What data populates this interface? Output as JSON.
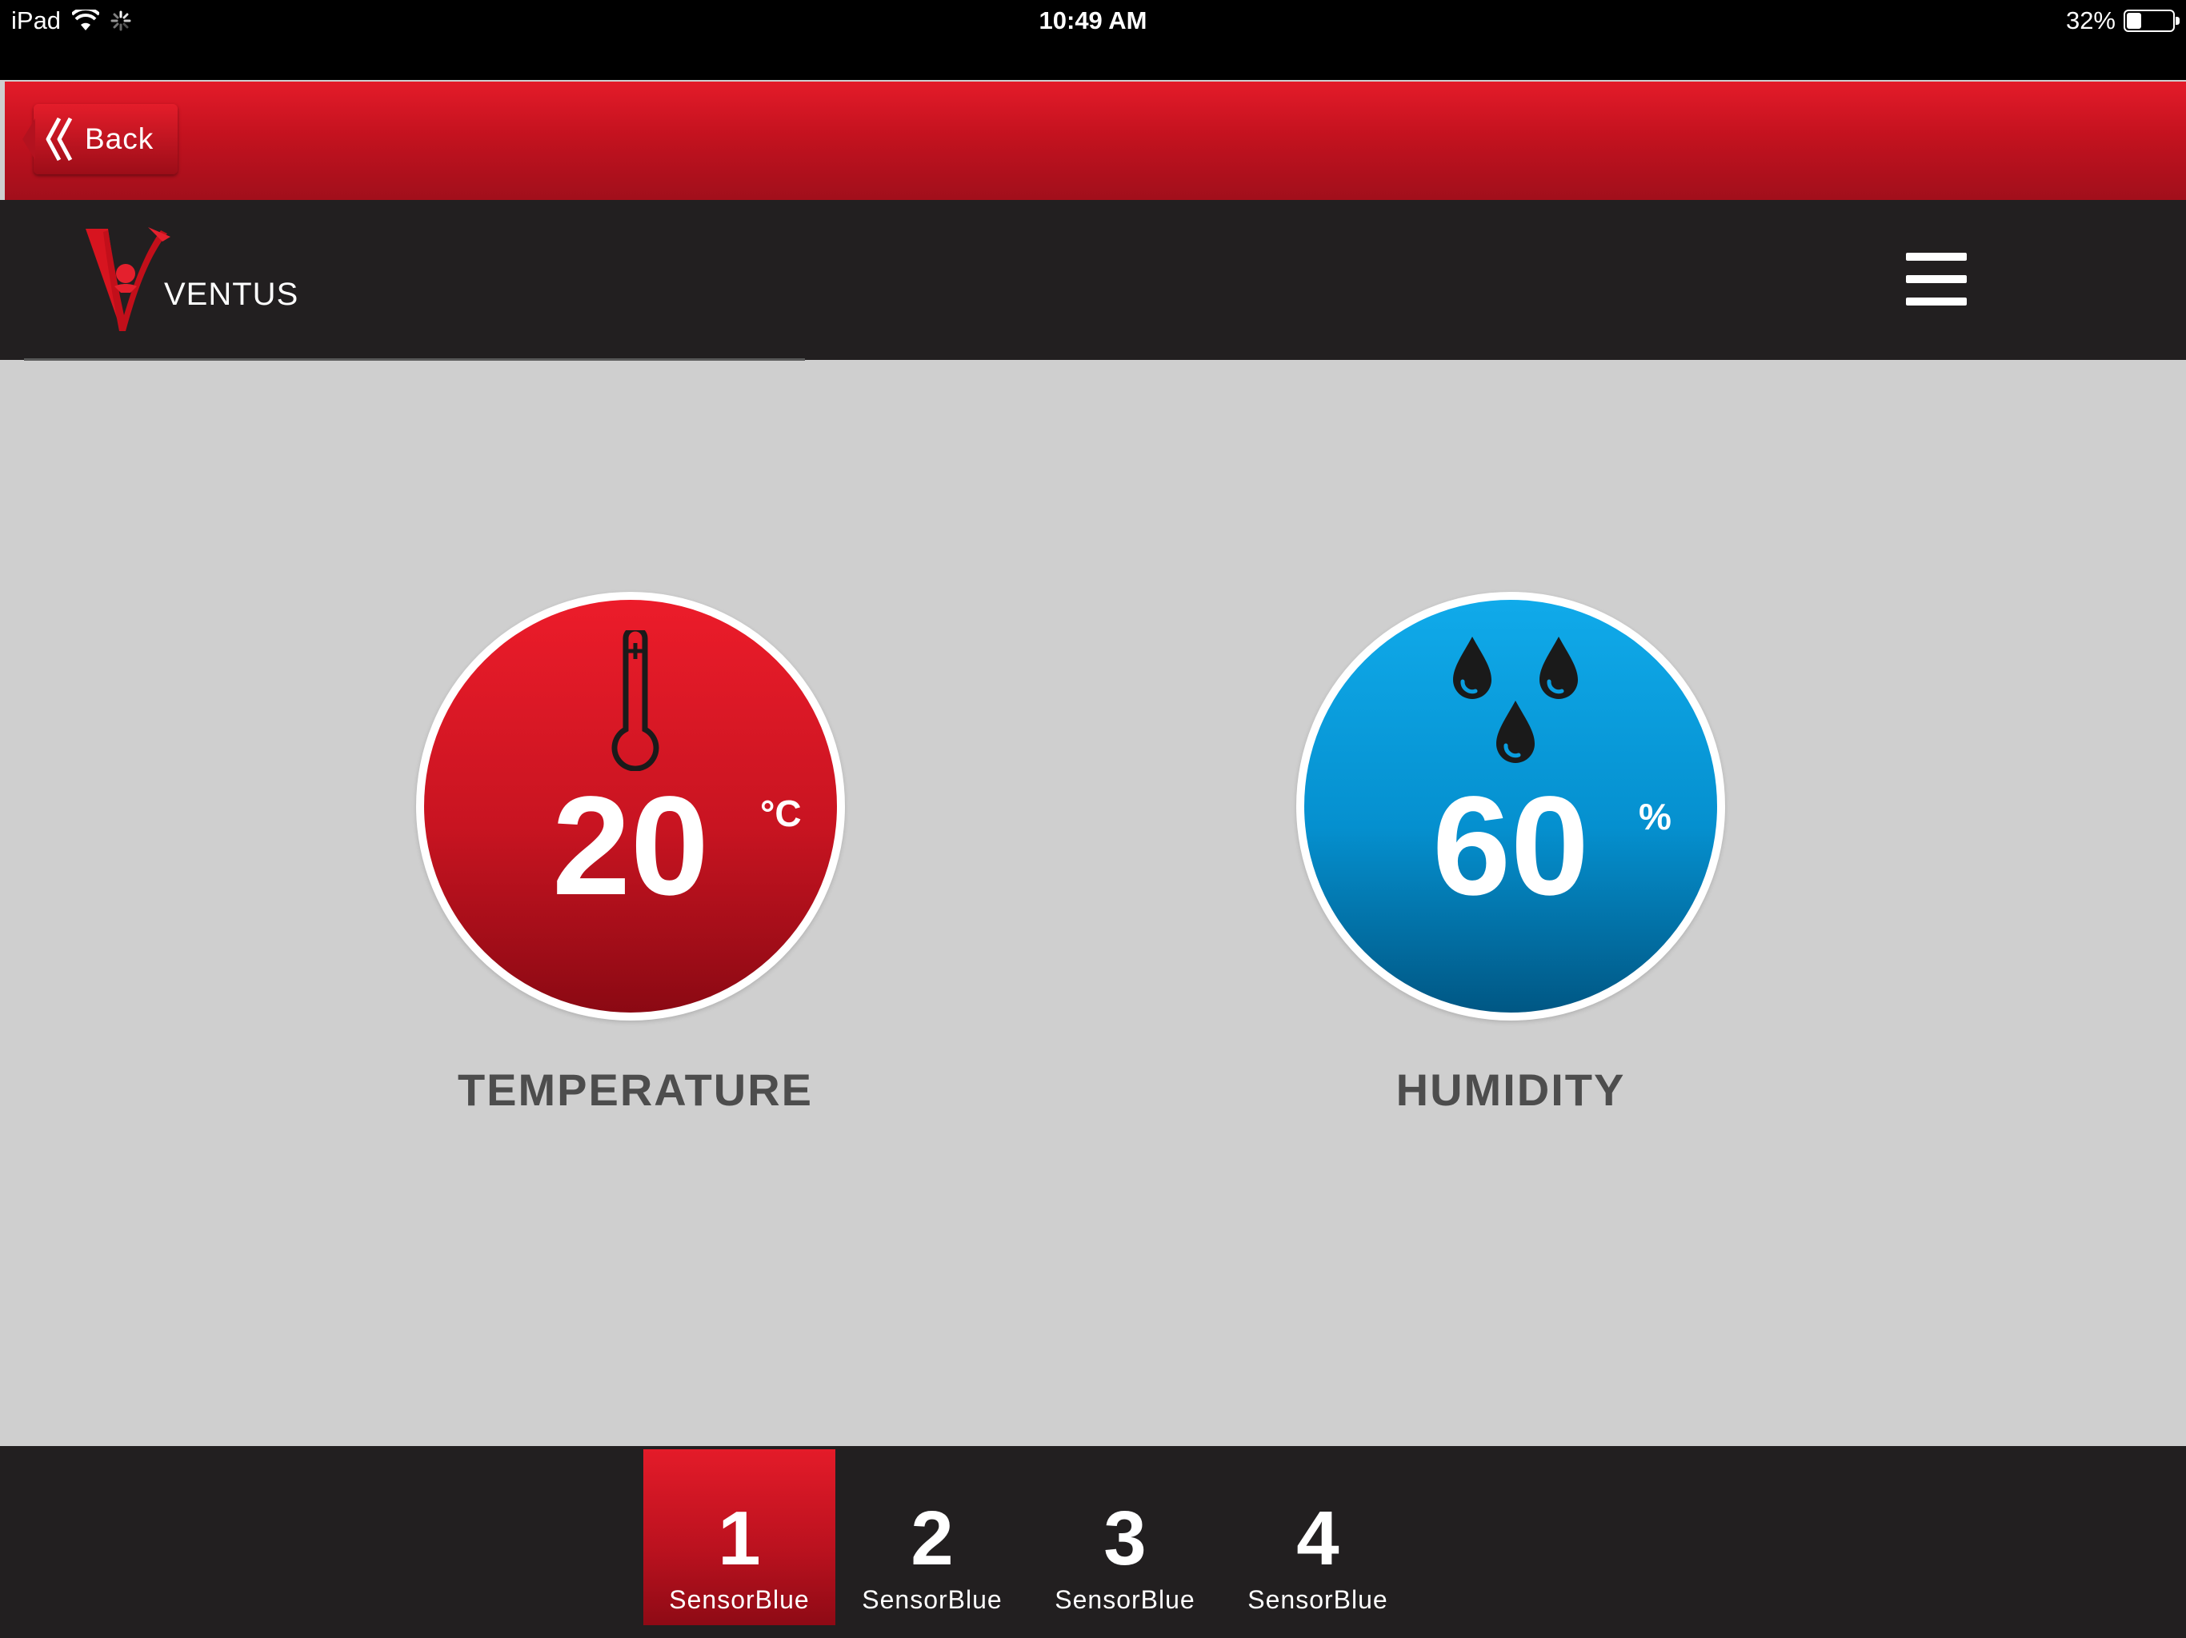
{
  "status_bar": {
    "device": "iPad",
    "time": "10:49 AM",
    "battery": "32%",
    "battery_level": 0.32
  },
  "header": {
    "back_label": "Back"
  },
  "nav": {
    "brand": "VENTUS",
    "menu_icon": "hamburger-menu-icon"
  },
  "gauges": {
    "temperature": {
      "value": "20",
      "unit": "°C",
      "label": "TEMPERATURE",
      "icon": "thermometer-icon",
      "color": "#d8192a"
    },
    "humidity": {
      "value": "60",
      "unit": "%",
      "label": "HUMIDITY",
      "icon": "water-drops-icon",
      "color": "#0a9ee0"
    }
  },
  "tabs": [
    {
      "number": "1",
      "label": "SensorBlue",
      "active": true
    },
    {
      "number": "2",
      "label": "SensorBlue",
      "active": false
    },
    {
      "number": "3",
      "label": "SensorBlue",
      "active": false
    },
    {
      "number": "4",
      "label": "SensorBlue",
      "active": false
    }
  ],
  "colors": {
    "accent_red": "#d8192a",
    "dark_bg": "#221f20",
    "content_bg": "#cfcfcf",
    "label_gray": "#4d4d4d"
  }
}
